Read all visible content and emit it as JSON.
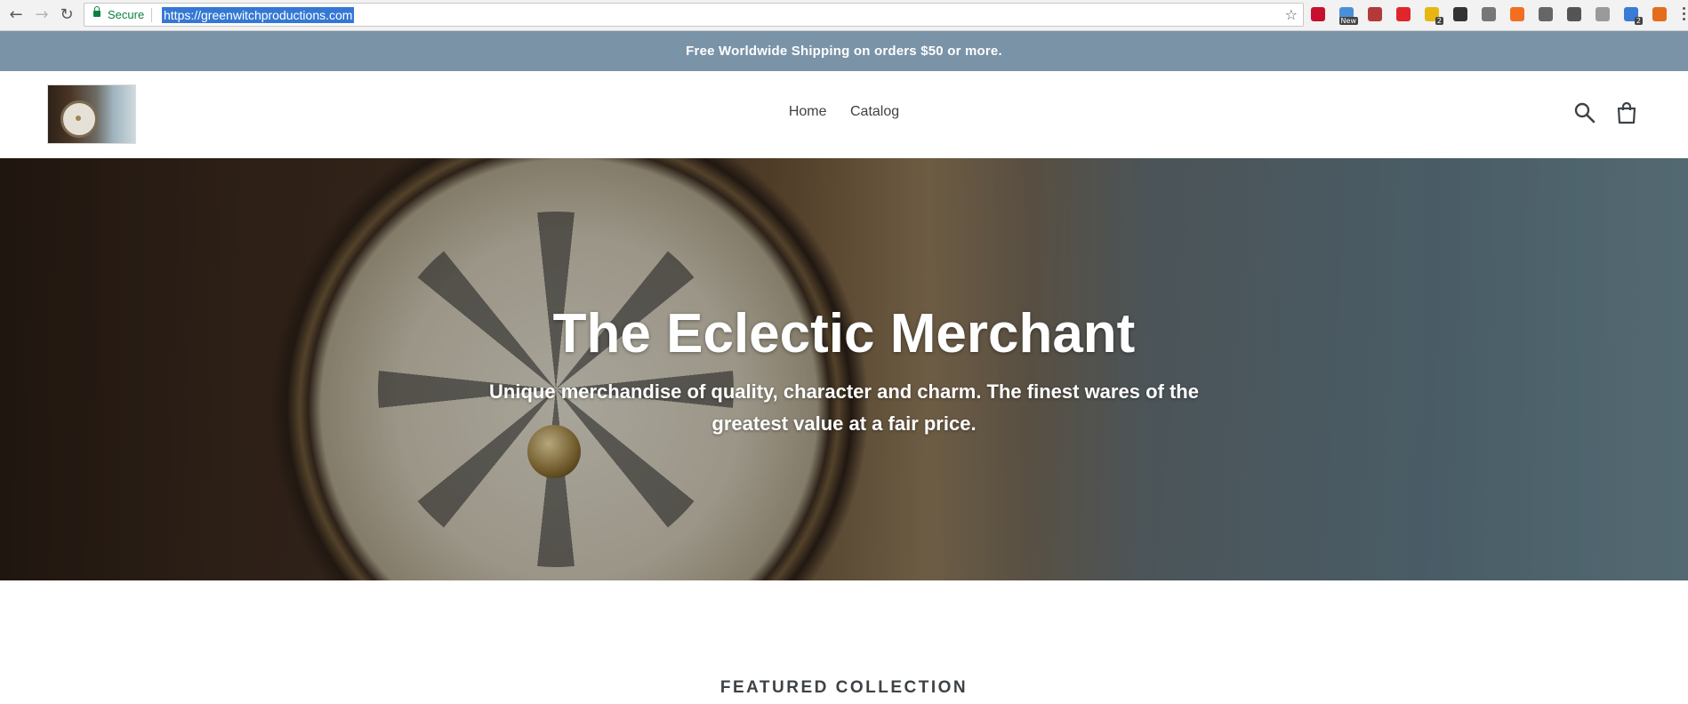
{
  "browser": {
    "secure_label": "Secure",
    "url": "https://greenwitchproductions.com",
    "extensions": [
      {
        "name": "abp-icon",
        "color": "#c8102e",
        "badge": ""
      },
      {
        "name": "new-extension-icon",
        "color": "#4a90d9",
        "badge": "New"
      },
      {
        "name": "pdf-icon",
        "color": "#b33a3a",
        "badge": ""
      },
      {
        "name": "opera-icon",
        "color": "#e0262a",
        "badge": ""
      },
      {
        "name": "notes-icon",
        "color": "#e7b70f",
        "badge": "2"
      },
      {
        "name": "exclamation-icon",
        "color": "#333333",
        "badge": ""
      },
      {
        "name": "window-icon",
        "color": "#777777",
        "badge": ""
      },
      {
        "name": "b-icon",
        "color": "#f26f21",
        "badge": ""
      },
      {
        "name": "eye-icon",
        "color": "#666666",
        "badge": ""
      },
      {
        "name": "filter-icon",
        "color": "#555555",
        "badge": ""
      },
      {
        "name": "cloud-icon",
        "color": "#9a9a9a",
        "badge": ""
      },
      {
        "name": "puzzle-icon",
        "color": "#3a7bd5",
        "badge": "2"
      },
      {
        "name": "fox-icon",
        "color": "#e56c1c",
        "badge": ""
      }
    ]
  },
  "announcement": {
    "text": "Free Worldwide Shipping on orders $50 or more."
  },
  "header": {
    "nav": [
      {
        "label": "Home"
      },
      {
        "label": "Catalog"
      }
    ]
  },
  "hero": {
    "title": "The Eclectic Merchant",
    "subtitle": "Unique merchandise of quality, character and charm.   The finest wares of the greatest value at a fair price."
  },
  "featured": {
    "heading": "FEATURED COLLECTION"
  },
  "colors": {
    "announcement_bg": "#7a93a7",
    "text_dark": "#3d4246"
  }
}
